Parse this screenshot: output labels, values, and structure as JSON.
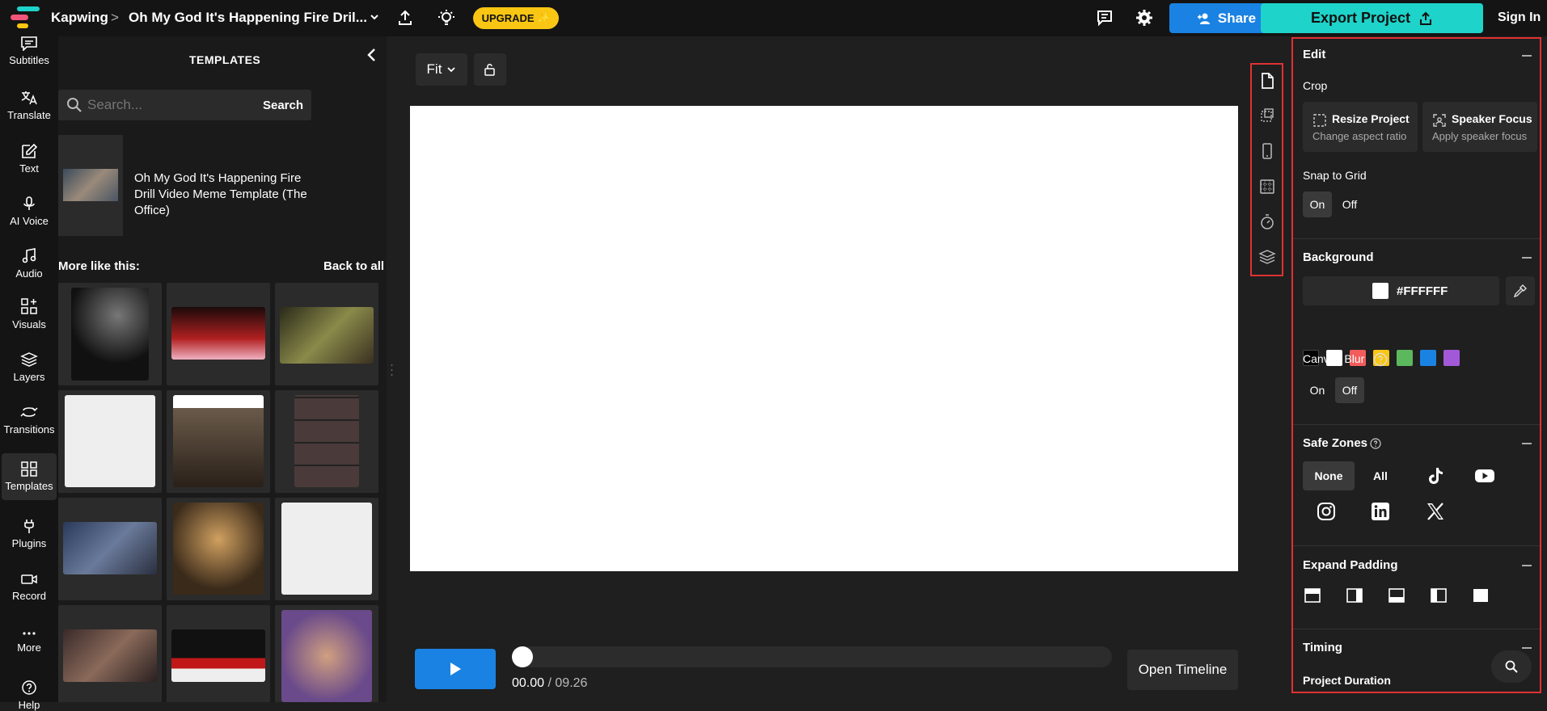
{
  "topbar": {
    "brand": "Kapwing",
    "breadcrumb_sep": ">",
    "project_title": "Oh My God It's Happening Fire Dril...",
    "upgrade_label": "UPGRADE ✨",
    "share_label": "Share",
    "export_label": "Export Project",
    "signin_label": "Sign In"
  },
  "nav": {
    "items": [
      {
        "label": "Subtitles"
      },
      {
        "label": "Translate"
      },
      {
        "label": "Text"
      },
      {
        "label": "AI Voice"
      },
      {
        "label": "Audio"
      },
      {
        "label": "Visuals"
      },
      {
        "label": "Layers"
      },
      {
        "label": "Transitions"
      },
      {
        "label": "Templates"
      },
      {
        "label": "Plugins"
      },
      {
        "label": "Record"
      },
      {
        "label": "More"
      },
      {
        "label": "Help"
      }
    ]
  },
  "templates": {
    "title": "TEMPLATES",
    "search_placeholder": "Search...",
    "search_button": "Search",
    "current_title": "Oh My God It's Happening Fire Drill Video Meme Template (The Office)",
    "more_like_this": "More like this:",
    "back_to_all": "Back to all"
  },
  "canvas": {
    "fit_label": "Fit",
    "time_current": "00.00",
    "time_sep": " / ",
    "time_total": "09.26",
    "open_timeline": "Open Timeline",
    "progress": 0
  },
  "edit": {
    "title": "Edit",
    "crop_label": "Crop",
    "resize_title": "Resize Project",
    "resize_sub": "Change aspect ratio",
    "speaker_title": "Speaker Focus",
    "speaker_sub": "Apply speaker focus",
    "snap_label": "Snap to Grid",
    "snap_on": "On",
    "snap_off": "Off"
  },
  "background": {
    "title": "Background",
    "hex": "#FFFFFF",
    "swatches": [
      "#000000",
      "#ffffff",
      "#f25c5c",
      "#f9c613",
      "#5cb85c",
      "#1a82e2",
      "#a259d9"
    ],
    "blur_label": "Canvas Blur",
    "blur_on": "On",
    "blur_off": "Off"
  },
  "safezones": {
    "title": "Safe Zones",
    "none": "None",
    "all": "All"
  },
  "padding": {
    "title": "Expand Padding"
  },
  "timing": {
    "title": "Timing",
    "duration_label": "Project Duration"
  },
  "colors": {
    "accent_blue": "#1a82e2",
    "accent_teal": "#1ed3c9",
    "upgrade_yellow": "#f9c613",
    "highlight_red": "#e03131"
  }
}
